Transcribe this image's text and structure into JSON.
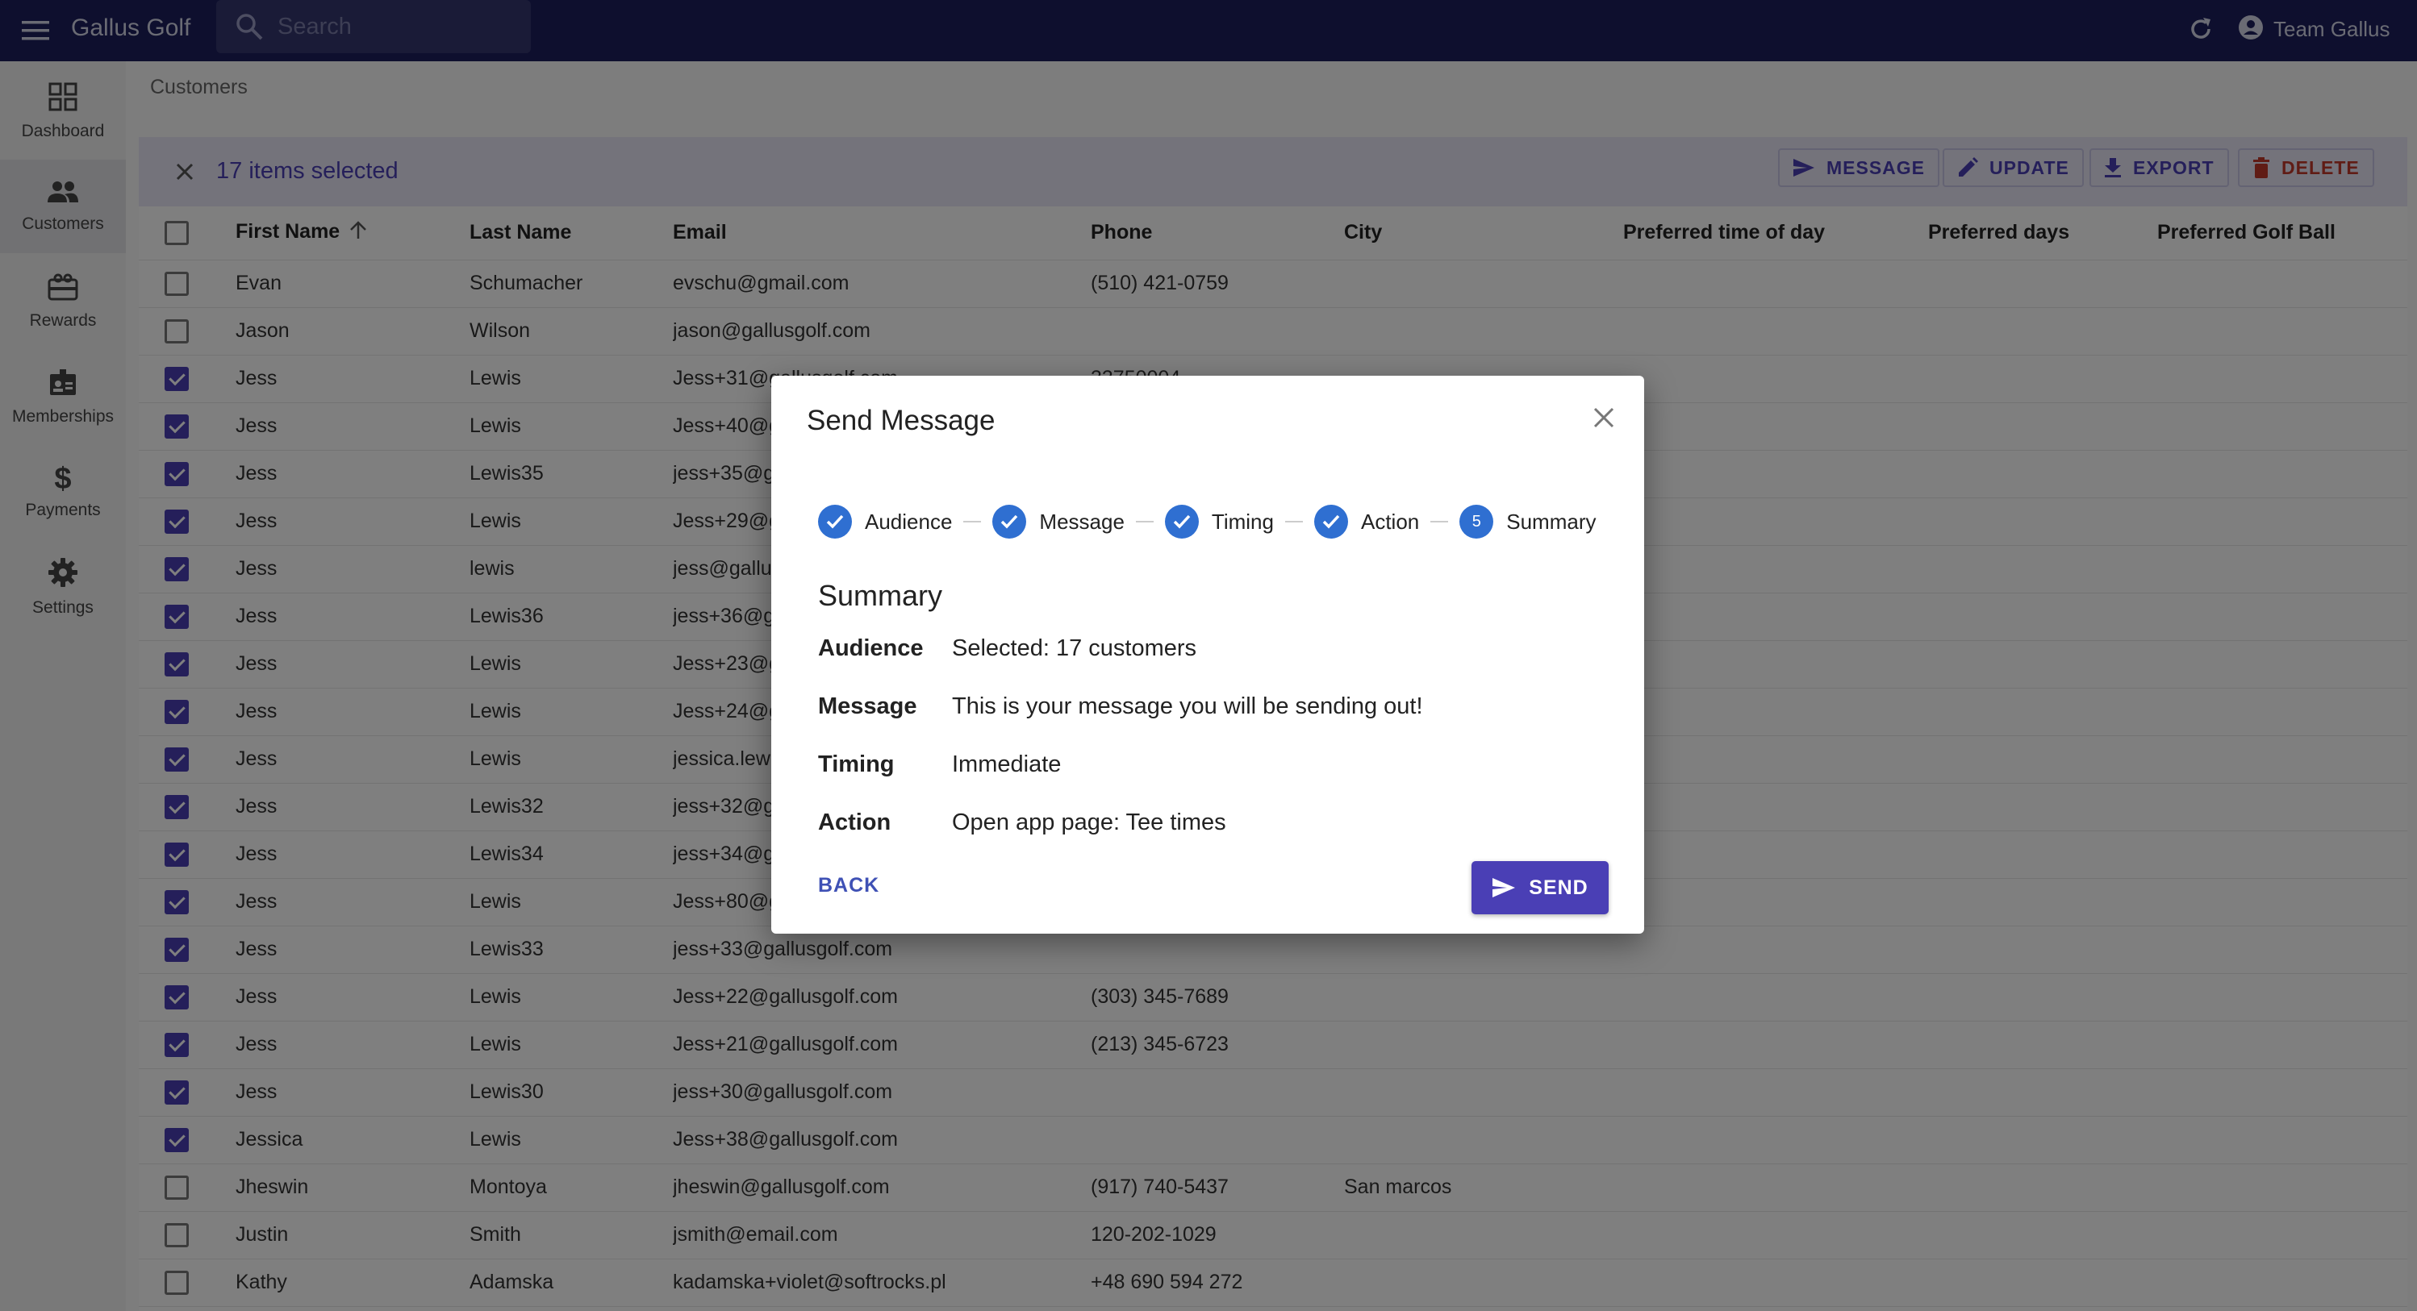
{
  "app": {
    "title": "Gallus Golf",
    "search_placeholder": "Search",
    "account_name": "Team Gallus",
    "colors": {
      "appbar": "#1c1f5c",
      "accent": "#4a3fb5",
      "step": "#2f6fd1",
      "danger": "#c0392b"
    }
  },
  "sidebar": {
    "items": [
      {
        "label": "Dashboard",
        "icon": "dashboard-icon"
      },
      {
        "label": "Customers",
        "icon": "people-icon",
        "active": true
      },
      {
        "label": "Rewards",
        "icon": "gift-card-icon"
      },
      {
        "label": "Memberships",
        "icon": "badge-icon"
      },
      {
        "label": "Payments",
        "icon": "dollar-icon"
      },
      {
        "label": "Settings",
        "icon": "gear-icon"
      }
    ]
  },
  "breadcrumb": "Customers",
  "selection": {
    "count_label": "17 items selected",
    "actions": {
      "message": "MESSAGE",
      "update": "UPDATE",
      "export": "EXPORT",
      "delete": "DELETE"
    }
  },
  "table": {
    "columns": [
      "First Name",
      "Last Name",
      "Email",
      "Phone",
      "City",
      "Preferred time of day",
      "Preferred days",
      "Preferred Golf Ball"
    ],
    "sort_column": "First Name",
    "rows": [
      {
        "checked": false,
        "first": "Evan",
        "last": "Schumacher",
        "email": "evschu@gmail.com",
        "phone": "(510) 421-0759",
        "city": ""
      },
      {
        "checked": false,
        "first": "Jason",
        "last": "Wilson",
        "email": "jason@gallusgolf.com",
        "phone": "",
        "city": ""
      },
      {
        "checked": true,
        "first": "Jess",
        "last": "Lewis",
        "email": "Jess+31@gallusgolf.com",
        "phone": "33750004",
        "city": ""
      },
      {
        "checked": true,
        "first": "Jess",
        "last": "Lewis",
        "email": "Jess+40@gallusgolf.com",
        "phone": "",
        "city": ""
      },
      {
        "checked": true,
        "first": "Jess",
        "last": "Lewis35",
        "email": "jess+35@gallusgolf.com",
        "phone": "",
        "city": ""
      },
      {
        "checked": true,
        "first": "Jess",
        "last": "Lewis",
        "email": "Jess+29@gallusgolf.com",
        "phone": "",
        "city": ""
      },
      {
        "checked": true,
        "first": "Jess",
        "last": "lewis",
        "email": "jess@gallusgolf.com",
        "phone": "",
        "city": ""
      },
      {
        "checked": true,
        "first": "Jess",
        "last": "Lewis36",
        "email": "jess+36@gallusgolf.com",
        "phone": "",
        "city": ""
      },
      {
        "checked": true,
        "first": "Jess",
        "last": "Lewis",
        "email": "Jess+23@gallusgolf.com",
        "phone": "",
        "city": ""
      },
      {
        "checked": true,
        "first": "Jess",
        "last": "Lewis",
        "email": "Jess+24@gallusgolf.com",
        "phone": "",
        "city": ""
      },
      {
        "checked": true,
        "first": "Jess",
        "last": "Lewis",
        "email": "jessica.lewis@gallusgolf.com",
        "phone": "",
        "city": ""
      },
      {
        "checked": true,
        "first": "Jess",
        "last": "Lewis32",
        "email": "jess+32@gallusgolf.com",
        "phone": "",
        "city": ""
      },
      {
        "checked": true,
        "first": "Jess",
        "last": "Lewis34",
        "email": "jess+34@gallusgolf.com",
        "phone": "",
        "city": ""
      },
      {
        "checked": true,
        "first": "Jess",
        "last": "Lewis",
        "email": "Jess+80@gallusgolf.com",
        "phone": "",
        "city": ""
      },
      {
        "checked": true,
        "first": "Jess",
        "last": "Lewis33",
        "email": "jess+33@gallusgolf.com",
        "phone": "",
        "city": ""
      },
      {
        "checked": true,
        "first": "Jess",
        "last": "Lewis",
        "email": "Jess+22@gallusgolf.com",
        "phone": "(303) 345-7689",
        "city": ""
      },
      {
        "checked": true,
        "first": "Jess",
        "last": "Lewis",
        "email": "Jess+21@gallusgolf.com",
        "phone": "(213) 345-6723",
        "city": ""
      },
      {
        "checked": true,
        "first": "Jess",
        "last": "Lewis30",
        "email": "jess+30@gallusgolf.com",
        "phone": "",
        "city": ""
      },
      {
        "checked": true,
        "first": "Jessica",
        "last": "Lewis",
        "email": "Jess+38@gallusgolf.com",
        "phone": "",
        "city": ""
      },
      {
        "checked": false,
        "first": "Jheswin",
        "last": "Montoya",
        "email": "jheswin@gallusgolf.com",
        "phone": "(917) 740-5437",
        "city": "San marcos"
      },
      {
        "checked": false,
        "first": "Justin",
        "last": "Smith",
        "email": "jsmith@email.com",
        "phone": "120-202-1029",
        "city": ""
      },
      {
        "checked": false,
        "first": "Kathy",
        "last": "Adamska",
        "email": "kadamska+violet@softrocks.pl",
        "phone": "+48 690 594 272",
        "city": ""
      }
    ]
  },
  "dialog": {
    "title": "Send Message",
    "steps": [
      {
        "label": "Audience",
        "done": true
      },
      {
        "label": "Message",
        "done": true
      },
      {
        "label": "Timing",
        "done": true
      },
      {
        "label": "Action",
        "done": true
      },
      {
        "label": "Summary",
        "done": false,
        "number": "5"
      }
    ],
    "summary_title": "Summary",
    "summary": [
      {
        "key": "Audience",
        "value": "Selected: 17 customers"
      },
      {
        "key": "Message",
        "value": "This is your message you will be sending out!"
      },
      {
        "key": "Timing",
        "value": "Immediate"
      },
      {
        "key": "Action",
        "value": "Open app page: Tee times"
      }
    ],
    "back_label": "BACK",
    "send_label": "SEND"
  }
}
